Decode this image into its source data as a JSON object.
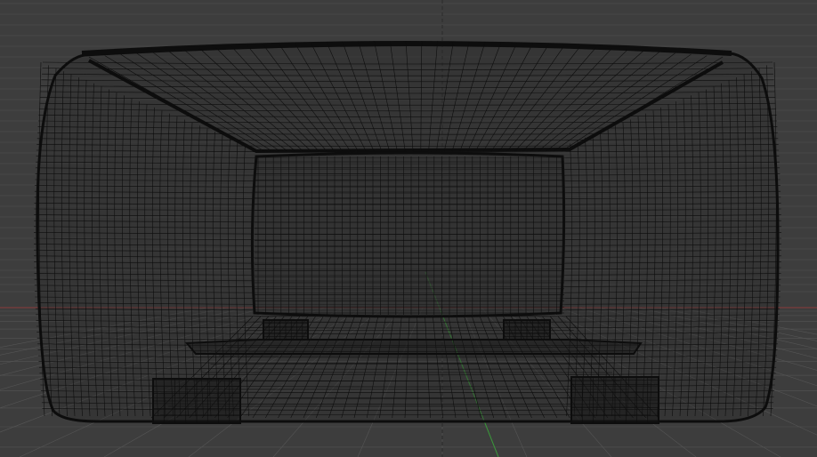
{
  "viewport": {
    "background_color": "#3d3d3d",
    "wire_color": "#0d0d0d",
    "grid_color": "#555555",
    "grid_dim_color": "#4a4a4a",
    "x_axis_color": "#8a3a3a",
    "y_axis_color": "#3a9a3a",
    "z_axis_color": "#2a2a2a"
  }
}
